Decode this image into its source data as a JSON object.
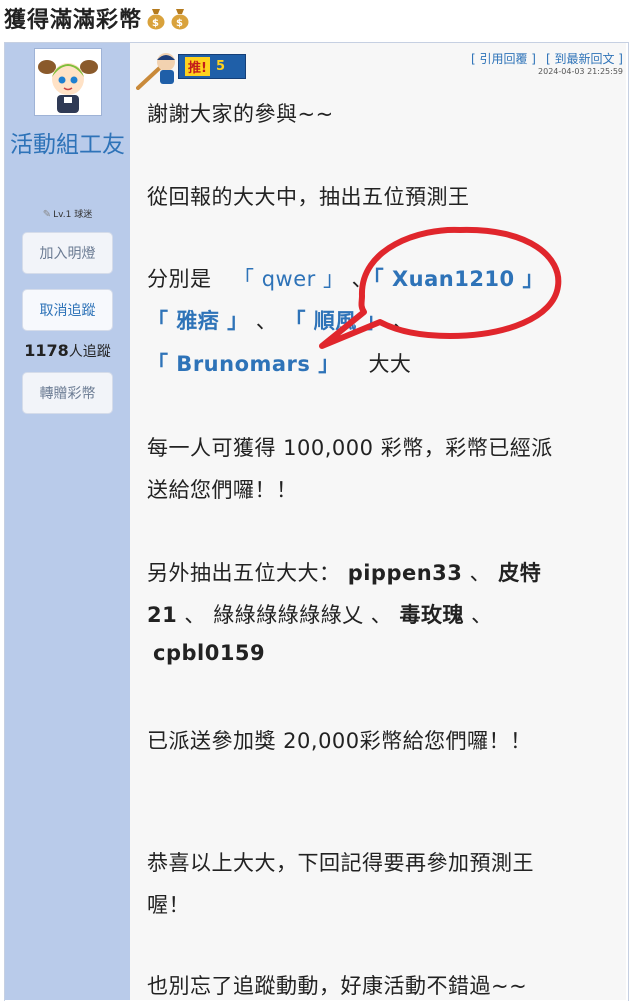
{
  "page": {
    "title": "獲得滿滿彩幣",
    "title_icons": [
      "money-bag-icon",
      "money-bag-icon"
    ]
  },
  "author": {
    "name": "活動組工友",
    "level": "Lv.1",
    "rank": "球迷",
    "buttons": {
      "add_light": "加入明燈",
      "unfollow": "取消追蹤",
      "gift": "轉贈彩幣"
    },
    "followers_count": "1178",
    "followers_label": "人追蹤"
  },
  "post": {
    "push_label": "推!",
    "push_count": "5",
    "quote_reply": "[ 引用回覆 ]",
    "goto_latest": "[ 到最新回文 ]",
    "timestamp": "2024-04-03 21:25:59",
    "body": {
      "l1": "謝謝大家的參與~~",
      "l2": "從回報的大大中，抽出五位預測王",
      "l3_prefix": "分別是",
      "winner1": "「 qwer 」",
      "sep1": "、",
      "winner2": "「 Xuan1210 」",
      "winner3": "「 雅痞 」",
      "sep2": "、",
      "winner4": "「 順風 」",
      "sep3": "、",
      "winner5": "「 Brunomars 」",
      "l5_suffix": "大大",
      "l6": "每一人可獲得 100,000 彩幣，彩幣已經派",
      "l7": "送給您們囉！！",
      "l8_prefix": "另外抽出五位大大：",
      "extra1": "pippen33",
      "sep4": "、",
      "extra2a": "皮特",
      "extra2b": "21",
      "sep5": "、",
      "extra3": "綠綠綠綠綠綠乂",
      "sep6": "、",
      "extra4": "毒玫瑰",
      "sep7": "、",
      "extra5": "cpbl0159",
      "l11": "已派送參加獎 20,000彩幣給您們囉！！",
      "l12": "恭喜以上大大，下回記得要再參加預測王",
      "l13": "喔！",
      "l14": "也別忘了追蹤動動，好康活動不錯過~~"
    }
  },
  "colors": {
    "sidebar_bg": "#b9cbea",
    "link_blue": "#2e73b8",
    "callout_red": "#e0262c",
    "push_blue": "#1f5fa8"
  }
}
